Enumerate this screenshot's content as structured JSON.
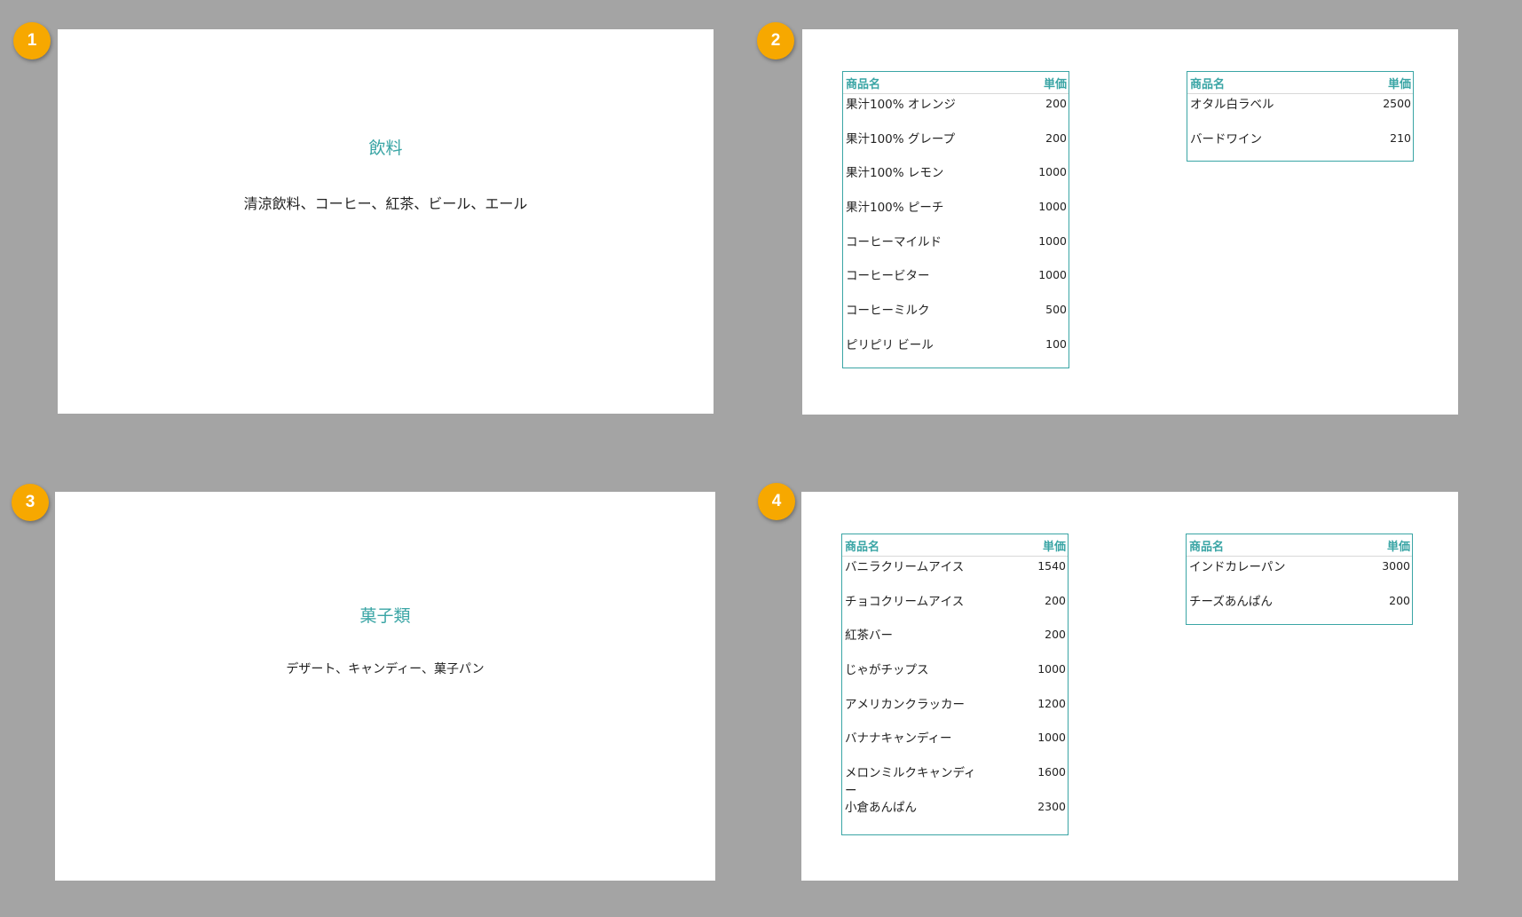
{
  "badges": [
    "1",
    "2",
    "3",
    "4"
  ],
  "slide1": {
    "title": "飲料",
    "description": "清涼飲料、コーヒー、紅茶、ビール、エール"
  },
  "slide2": {
    "table_left": {
      "header": {
        "name": "商品名",
        "price": "単価"
      },
      "rows": [
        {
          "name": "果汁100% オレンジ",
          "price": "200"
        },
        {
          "name": "果汁100% グレープ",
          "price": "200"
        },
        {
          "name": "果汁100% レモン",
          "price": "1000"
        },
        {
          "name": "果汁100% ピーチ",
          "price": "1000"
        },
        {
          "name": "コーヒーマイルド",
          "price": "1000"
        },
        {
          "name": "コーヒービター",
          "price": "1000"
        },
        {
          "name": "コーヒーミルク",
          "price": "500"
        },
        {
          "name": "ピリピリ ビール",
          "price": "100"
        }
      ]
    },
    "table_right": {
      "header": {
        "name": "商品名",
        "price": "単価"
      },
      "rows": [
        {
          "name": "オタル白ラベル",
          "price": "2500"
        },
        {
          "name": "バードワイン",
          "price": "210"
        }
      ]
    }
  },
  "slide3": {
    "title": "菓子類",
    "description": "デザート、キャンディー、菓子パン"
  },
  "slide4": {
    "table_left": {
      "header": {
        "name": "商品名",
        "price": "単価"
      },
      "rows": [
        {
          "name": "バニラクリームアイス",
          "price": "1540"
        },
        {
          "name": "チョコクリームアイス",
          "price": "200"
        },
        {
          "name": "紅茶バー",
          "price": "200"
        },
        {
          "name": "じゃがチップス",
          "price": "1000"
        },
        {
          "name": "アメリカンクラッカー",
          "price": "1200"
        },
        {
          "name": "バナナキャンディー",
          "price": "1000"
        },
        {
          "name": "メロンミルクキャンディー",
          "price": "1600"
        },
        {
          "name": "小倉あんぱん",
          "price": "2300"
        }
      ]
    },
    "table_right": {
      "header": {
        "name": "商品名",
        "price": "単価"
      },
      "rows": [
        {
          "name": "インドカレーパン",
          "price": "3000"
        },
        {
          "name": "チーズあんぱん",
          "price": "200"
        }
      ]
    }
  }
}
